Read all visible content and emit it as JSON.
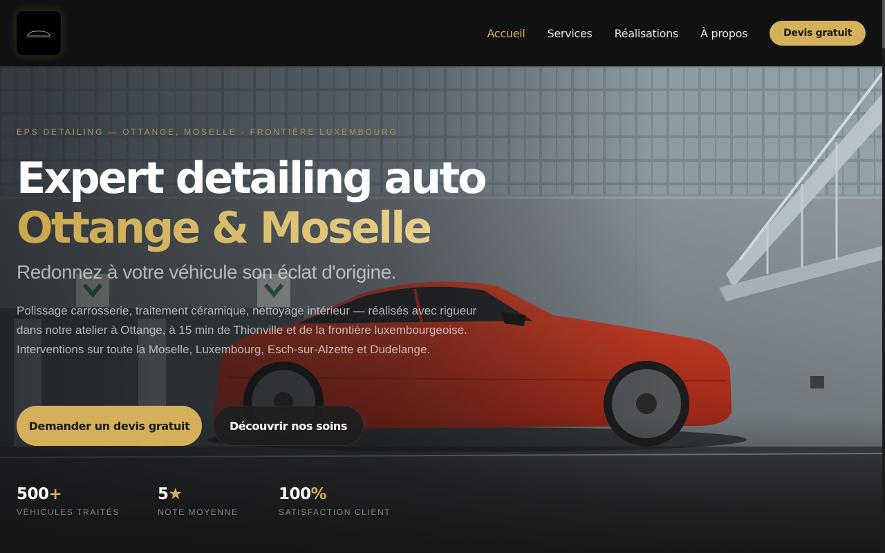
{
  "header": {
    "logo_alt": "EPS Detailing",
    "nav": [
      {
        "label": "Accueil",
        "active": true
      },
      {
        "label": "Services",
        "active": false
      },
      {
        "label": "Réalisations",
        "active": false
      },
      {
        "label": "À propos",
        "active": false
      }
    ],
    "cta_label": "Devis gratuit"
  },
  "hero": {
    "eyebrow": "EPS DETAILING — OTTANGE, MOSELLE · FRONTIÈRE LUXEMBOURG",
    "title_line1": "Expert detailing auto",
    "title_line2": "Ottange & Moselle",
    "subtitle": "Redonnez à votre véhicule son éclat d'origine.",
    "description_1": "Polissage carrosserie, traitement céramique, nettoyage intérieur — réalisés avec rigueur dans notre atelier à Ottange, à 15 min de Thionville et de la frontière luxembourgeoise.",
    "description_2": "Interventions sur toute la Moselle, Luxembourg, Esch-sur-Alzette et Dudelange.",
    "primary_button": "Demander un devis gratuit",
    "secondary_button": "Découvrir nos soins"
  },
  "stats": [
    {
      "value": "500",
      "accent": "+",
      "label": "Véhicules traités"
    },
    {
      "value": "5",
      "accent": "★",
      "label": "Note moyenne"
    },
    {
      "value": "100",
      "accent": "%",
      "label": "Satisfaction client"
    }
  ],
  "colors": {
    "accent": "#d4b05a",
    "header_bg": "#111111",
    "car": "#c8361f"
  }
}
